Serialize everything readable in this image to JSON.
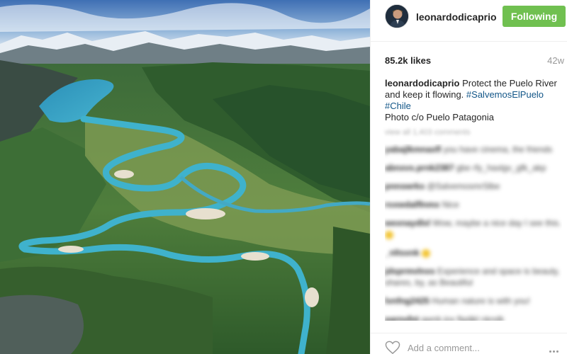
{
  "post": {
    "photo_icon": "landscape-photo",
    "avatar_icon": "profile-avatar"
  },
  "header": {
    "username": "leonardodicaprio",
    "follow_label": "Following",
    "follow_color": "#70c050"
  },
  "stats": {
    "likes": "85.2k likes",
    "timestamp": "42w"
  },
  "caption": {
    "username": "leonardodicaprio",
    "text": "Protect the Puelo River and keep it flowing.",
    "hashtag_1": "#SalvemosElPuelo",
    "hashtag_2": "#Chile",
    "credit": "Photo c/o Puelo Patagonia",
    "hashtag_color": "#125688"
  },
  "comments": {
    "load_more": "view all 1,403 comments",
    "items": [
      {
        "user": "yabajlkmnaxfl",
        "text": "you have cinema, the friends"
      },
      {
        "user": "abnxvs.prnk2387",
        "text": "gbe rfy_haxlgv_gfk_akp"
      },
      {
        "user": "pnnswrks",
        "text": "@SalvemosmrSlbe"
      },
      {
        "user": "roxwdalflnmx",
        "text": "Nice"
      },
      {
        "user": "wexnaydlxl",
        "text": "Wow, maybe a nice day I see this."
      },
      {
        "user": "_nltsxnk",
        "text": ""
      },
      {
        "user": "jdsprmvlnxs",
        "text": "Experience and space is beauty, shares, by, as Beautiful"
      },
      {
        "user": "lvnfng2425",
        "text": "Human nature is with you!"
      },
      {
        "user": "parnvfnt",
        "text": "qwnb jnx flgdjkl nkndk"
      }
    ]
  },
  "footer": {
    "placeholder": "Add a comment...",
    "heart_icon": "heart-icon",
    "more_icon": "more-options-icon"
  }
}
